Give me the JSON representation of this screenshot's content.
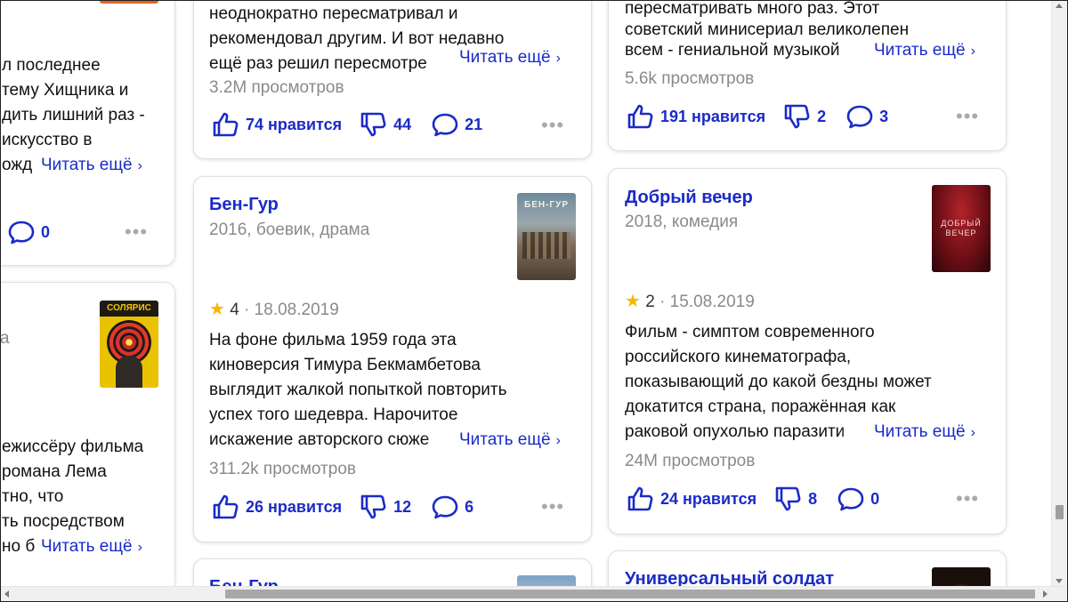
{
  "read_more": "Читать ещё",
  "left_card_top": {
    "lines": [
      "л последнее",
      "тему Хищника и",
      "дить лишний раз -",
      "искусство в",
      "ожд"
    ],
    "comments": "0"
  },
  "left_card_mid": {
    "meta_fragment": "а",
    "lines": [
      "ежиссёру фильма",
      "романа Лема",
      "тно, что",
      "ть посредством",
      "но б"
    ]
  },
  "card_a_top": {
    "lines": [
      "неоднократно пересматривал и",
      "рекомендовал другим. И вот недавно",
      "ещё раз решил пересмотре"
    ],
    "views": "3.2M просмотров",
    "likes": "74 нравится",
    "dislikes": "44",
    "comments": "21"
  },
  "card_b_top": {
    "lines": [
      "пересматривать много раз. Этот",
      "советский минисериал великолепен",
      "всем - гениальной музыкой"
    ],
    "views": "5.6k просмотров",
    "likes": "191 нравится",
    "dislikes": "2",
    "comments": "3"
  },
  "card_a_mid": {
    "title": "Бен-Гур",
    "meta": "2016, боевик, драма",
    "rating": "4",
    "date": "· 18.08.2019",
    "lines": [
      "На фоне фильма 1959 года эта",
      "киноверсия Тимура Бекмамбетова",
      "выглядит жалкой попыткой повторить",
      "успех того шедевра. Нарочитое",
      "искажение авторского сюже"
    ],
    "views": "311.2k просмотров",
    "likes": "26 нравится",
    "dislikes": "12",
    "comments": "6"
  },
  "card_b_mid": {
    "title": "Добрый вечер",
    "meta": "2018, комедия",
    "rating": "2",
    "date": "· 15.08.2019",
    "lines": [
      "Фильм - симптом современного",
      "российского кинематографа,",
      "показывающий до какой бездны может",
      "докатится страна, поражённая как",
      "раковой опухолью паразити"
    ],
    "views": "24M просмотров",
    "likes": "24 нравится",
    "dislikes": "8",
    "comments": "0"
  },
  "card_a_bottom": {
    "title": "Бен-Гур"
  },
  "card_b_bottom": {
    "title": "Универсальный солдат"
  },
  "posters": {
    "solaris_text": "СОЛЯРИС",
    "benhur_text": "БЕН-ГУР",
    "dobry_text": "ДОБРЫЙ ВЕЧЕР"
  },
  "colors": {
    "link": "#1a2bc8",
    "star": "#f5b800",
    "muted": "#8a8a8a"
  }
}
